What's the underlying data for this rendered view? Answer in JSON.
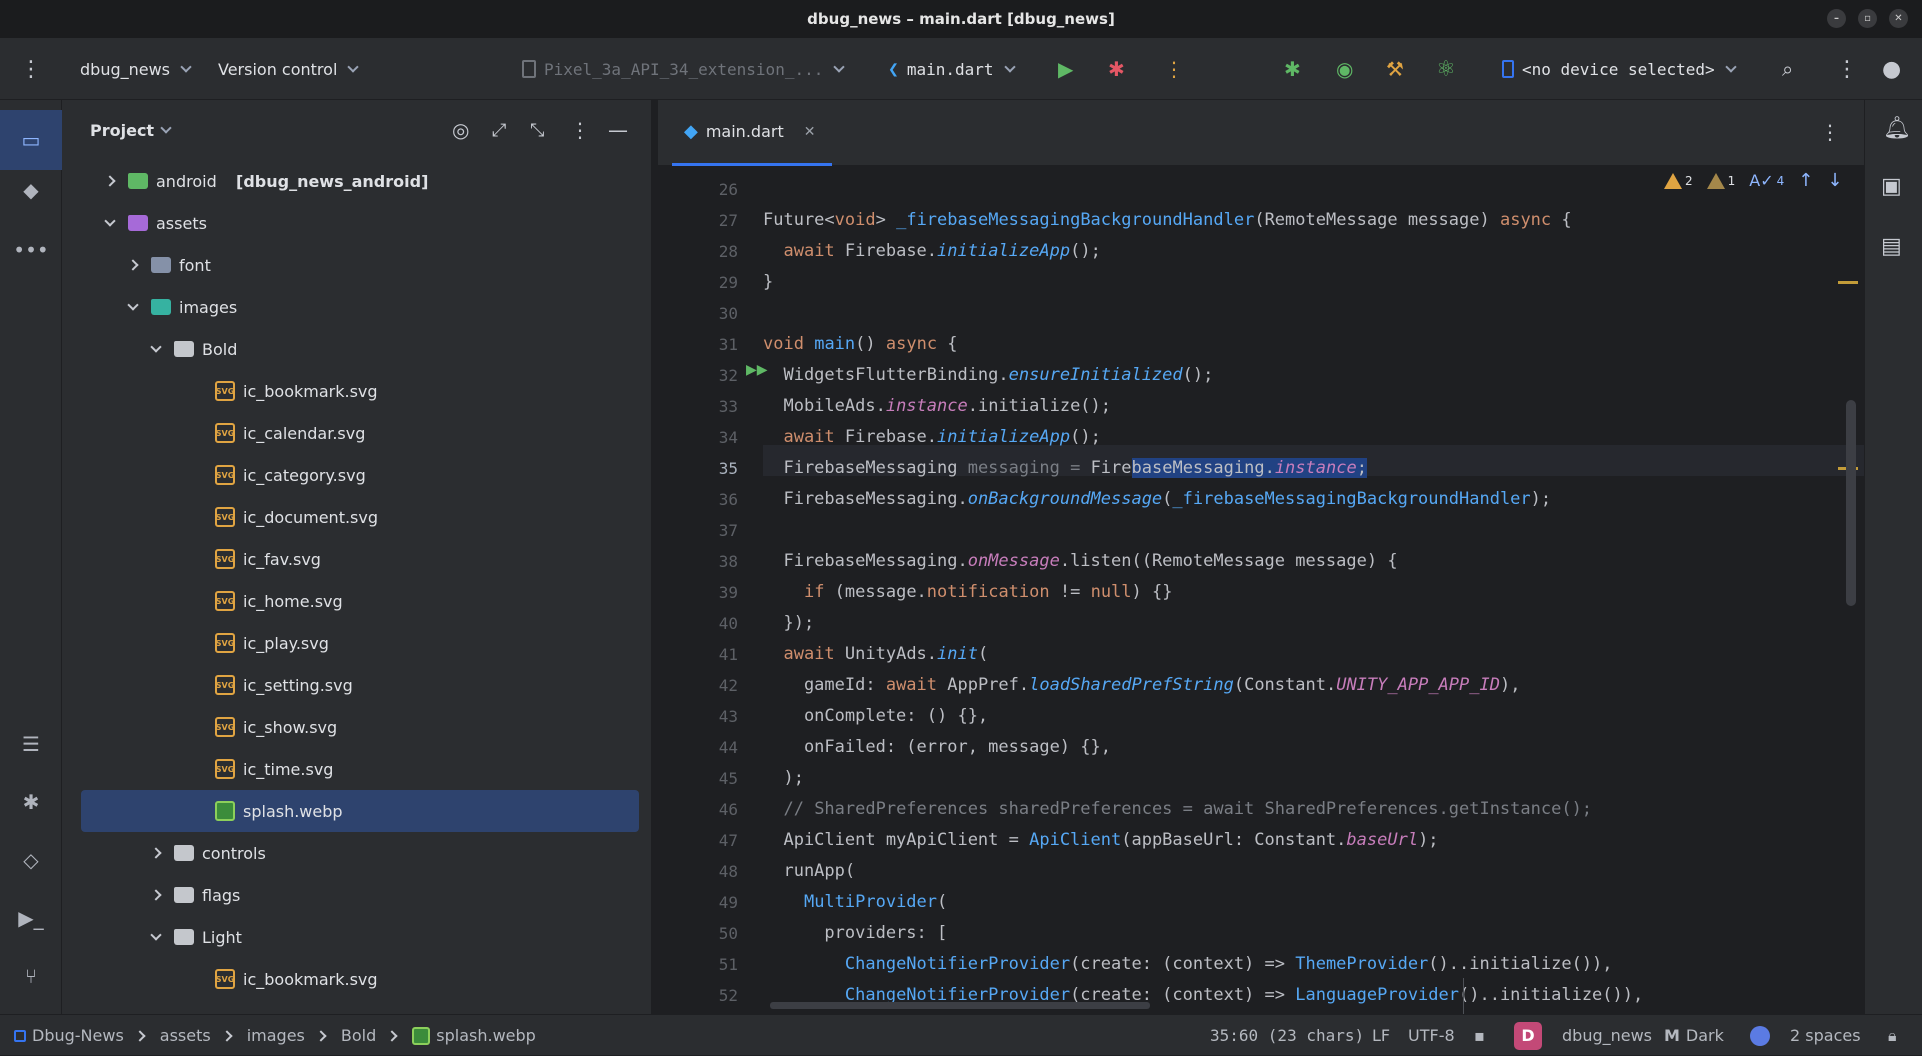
{
  "window": {
    "title": "dbug_news – main.dart [dbug_news]"
  },
  "toolbar": {
    "project": "dbug_news",
    "vcs": "Version control",
    "device_config": "Pixel_3a_API_34_extension_...",
    "run_config": "main.dart",
    "device": "<no device selected>"
  },
  "panel": {
    "title": "Project",
    "tree": [
      {
        "label": "android",
        "suffix": "[dbug_news_android]",
        "kind": "android",
        "indent": 0,
        "expanded": false
      },
      {
        "label": "assets",
        "kind": "assets",
        "indent": 0,
        "expanded": true
      },
      {
        "label": "font",
        "kind": "font",
        "indent": 1,
        "expanded": false
      },
      {
        "label": "images",
        "kind": "images",
        "indent": 1,
        "expanded": true
      },
      {
        "label": "Bold",
        "kind": "folder",
        "indent": 2,
        "expanded": true
      },
      {
        "label": "ic_bookmark.svg",
        "kind": "svg",
        "indent": 3
      },
      {
        "label": "ic_calendar.svg",
        "kind": "svg",
        "indent": 3
      },
      {
        "label": "ic_category.svg",
        "kind": "svg",
        "indent": 3
      },
      {
        "label": "ic_document.svg",
        "kind": "svg",
        "indent": 3
      },
      {
        "label": "ic_fav.svg",
        "kind": "svg",
        "indent": 3
      },
      {
        "label": "ic_home.svg",
        "kind": "svg",
        "indent": 3
      },
      {
        "label": "ic_play.svg",
        "kind": "svg",
        "indent": 3
      },
      {
        "label": "ic_setting.svg",
        "kind": "svg",
        "indent": 3
      },
      {
        "label": "ic_show.svg",
        "kind": "svg",
        "indent": 3
      },
      {
        "label": "ic_time.svg",
        "kind": "svg",
        "indent": 3
      },
      {
        "label": "splash.webp",
        "kind": "webp",
        "indent": 3,
        "selected": true
      },
      {
        "label": "controls",
        "kind": "folder",
        "indent": 2,
        "expanded": false
      },
      {
        "label": "flags",
        "kind": "folder",
        "indent": 2,
        "expanded": false
      },
      {
        "label": "Light",
        "kind": "folder",
        "indent": 2,
        "expanded": true
      },
      {
        "label": "ic_bookmark.svg",
        "kind": "svg",
        "indent": 3
      }
    ]
  },
  "editor": {
    "tab": "main.dart",
    "warnings": "2",
    "weak_warnings": "1",
    "typos": "4",
    "current_line": 35,
    "lines": [
      {
        "n": "26",
        "html": ""
      },
      {
        "n": "27",
        "html": "Future&lt;<span class=\"k\">void</span>&gt; <span class=\"f\">_firebaseMessagingBackgroundHandler</span>(RemoteMessage message) <span class=\"k\">async</span> {"
      },
      {
        "n": "28",
        "html": "  <span class=\"k\">await</span> Firebase.<span class=\"it\">initializeApp</span>();"
      },
      {
        "n": "29",
        "html": "}"
      },
      {
        "n": "30",
        "html": ""
      },
      {
        "n": "31",
        "html": "<span class=\"k\">void</span> <span class=\"f\">main</span>() <span class=\"k\">async</span> {"
      },
      {
        "n": "32",
        "html": "  WidgetsFlutterBinding.<span class=\"it\">ensureInitialized</span>();"
      },
      {
        "n": "33",
        "html": "  MobileAds.<span class=\"c\">instance</span>.initialize();"
      },
      {
        "n": "34",
        "html": "  <span class=\"k\">await</span> Firebase.<span class=\"it\">initializeApp</span>();"
      },
      {
        "n": "35",
        "html": "  FirebaseMessaging <span class=\"gr\">messaging</span> <span class=\"gr\">=</span> Fire<span class=\"sel\">baseMessaging.<span class=\"c\">instance</span>;</span>"
      },
      {
        "n": "36",
        "html": "  FirebaseMessaging.<span class=\"it\">onBackgroundMessage</span>(<span class=\"ty\">_firebaseMessagingBackgroundHandler</span>);"
      },
      {
        "n": "37",
        "html": ""
      },
      {
        "n": "38",
        "html": "  FirebaseMessaging.<span class=\"c\">onMessage</span>.listen((RemoteMessage message) {"
      },
      {
        "n": "39",
        "html": "    <span class=\"k\">if</span> (message.<span class=\"k\">notification</span> != <span class=\"k\">null</span>) {}"
      },
      {
        "n": "40",
        "html": "  });"
      },
      {
        "n": "41",
        "html": "  <span class=\"k\">await</span> UnityAds.<span class=\"it\">init</span>("
      },
      {
        "n": "42",
        "html": "    gameId: <span class=\"k\">await</span> AppPref.<span class=\"it\">loadSharedPrefString</span>(Constant.<span class=\"c\">UNITY_APP_APP_ID</span>),"
      },
      {
        "n": "43",
        "html": "    onComplete: () {},"
      },
      {
        "n": "44",
        "html": "    onFailed: (error, message) {},"
      },
      {
        "n": "45",
        "html": "  );"
      },
      {
        "n": "46",
        "html": "  <span class=\"cm\">// SharedPreferences sharedPreferences = await SharedPreferences.getInstance();</span>"
      },
      {
        "n": "47",
        "html": "  ApiClient myApiClient = <span class=\"ty\">ApiClient</span>(appBaseUrl: Constant.<span class=\"c\">baseUrl</span>);"
      },
      {
        "n": "48",
        "html": "  runApp("
      },
      {
        "n": "49",
        "html": "    <span class=\"ty\">MultiProvider</span>("
      },
      {
        "n": "50",
        "html": "      providers: ["
      },
      {
        "n": "51",
        "html": "        <span class=\"ty\">ChangeNotifierProvider</span>(create: (context) =&gt; <span class=\"ty\">ThemeProvider</span>()..initialize()),"
      },
      {
        "n": "52",
        "html": "        <span class=\"ty\">ChangeNotifierProvider</span>(create: (context) =&gt; <span class=\"ty\">LanguageProvider</span>()..initialize()),"
      }
    ]
  },
  "status": {
    "breadcrumb": [
      "Dbug-News",
      "assets",
      "images",
      "Bold",
      "splash.webp"
    ],
    "position": "35:60 (23 chars)",
    "line_sep": "LF",
    "encoding": "UTF-8",
    "avatar_letter": "D",
    "project": "dbug_news",
    "theme": "Dark",
    "indent": "2 spaces"
  },
  "colors": {
    "accent": "#3574f0",
    "selection": "#2e436e",
    "warning": "#e0a442"
  }
}
